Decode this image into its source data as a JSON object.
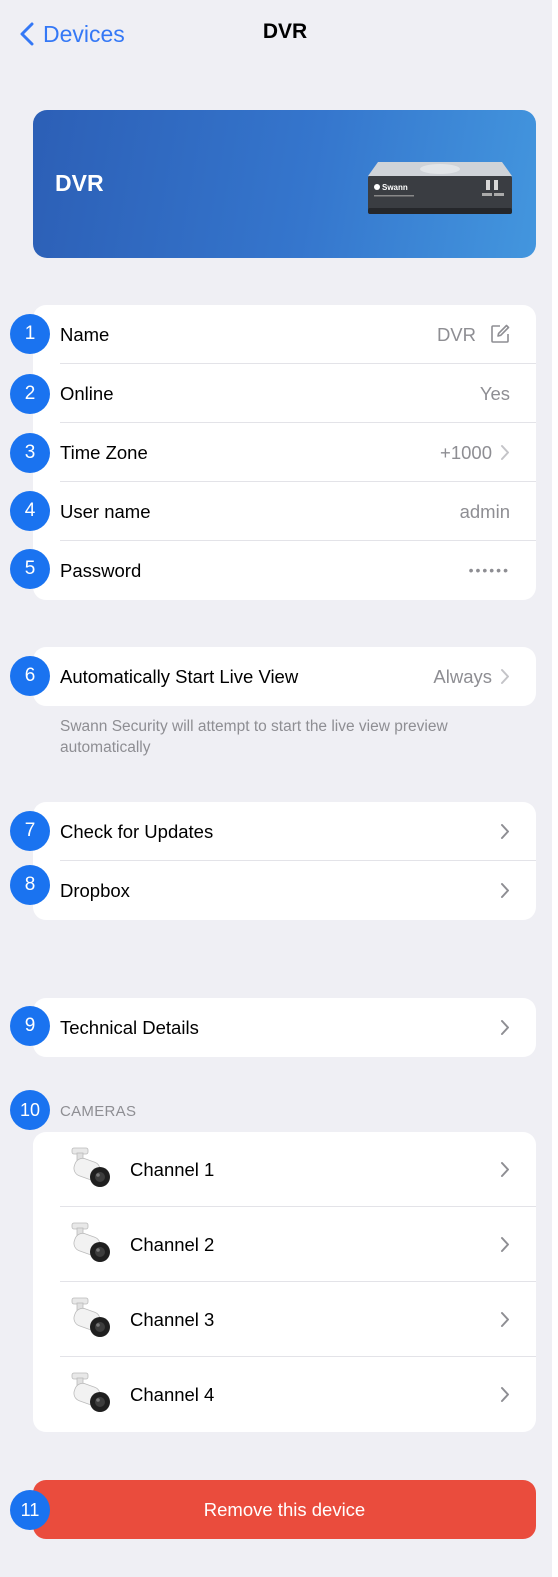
{
  "nav": {
    "back_label": "Devices",
    "title": "DVR"
  },
  "hero": {
    "title": "DVR",
    "brand": "Swann"
  },
  "device_info": [
    {
      "badge": "1",
      "label": "Name",
      "value": "DVR"
    },
    {
      "badge": "2",
      "label": "Online",
      "value": "Yes"
    },
    {
      "badge": "3",
      "label": "Time Zone",
      "value": "+1000"
    },
    {
      "badge": "4",
      "label": "User name",
      "value": "admin"
    },
    {
      "badge": "5",
      "label": "Password",
      "value": "••••••"
    }
  ],
  "live_view": {
    "badge": "6",
    "label": "Automatically Start Live View",
    "value": "Always",
    "footnote": "Swann Security will attempt to start the live view preview automatically"
  },
  "maintenance": [
    {
      "badge": "7",
      "label": "Check for Updates"
    },
    {
      "badge": "8",
      "label": "Dropbox"
    }
  ],
  "technical": {
    "badge": "9",
    "label": "Technical Details"
  },
  "cameras": {
    "badge": "10",
    "header": "CAMERAS",
    "items": [
      {
        "label": "Channel 1"
      },
      {
        "label": "Channel 2"
      },
      {
        "label": "Channel 3"
      },
      {
        "label": "Channel 4"
      }
    ]
  },
  "remove": {
    "badge": "11",
    "label": "Remove this device"
  },
  "colors": {
    "accent": "#3478f6",
    "badge": "#1a73f0",
    "hero_start": "#2c5fb6",
    "hero_end": "#4396de",
    "destructive": "#ea4c3d",
    "background": "#efeff4",
    "secondary_text": "#8e8e93"
  },
  "icons": {
    "back": "chevron-left-icon",
    "edit": "edit-icon",
    "disclosure": "chevron-right-icon",
    "camera": "bullet-camera-icon",
    "dvr": "dvr-device-image"
  }
}
